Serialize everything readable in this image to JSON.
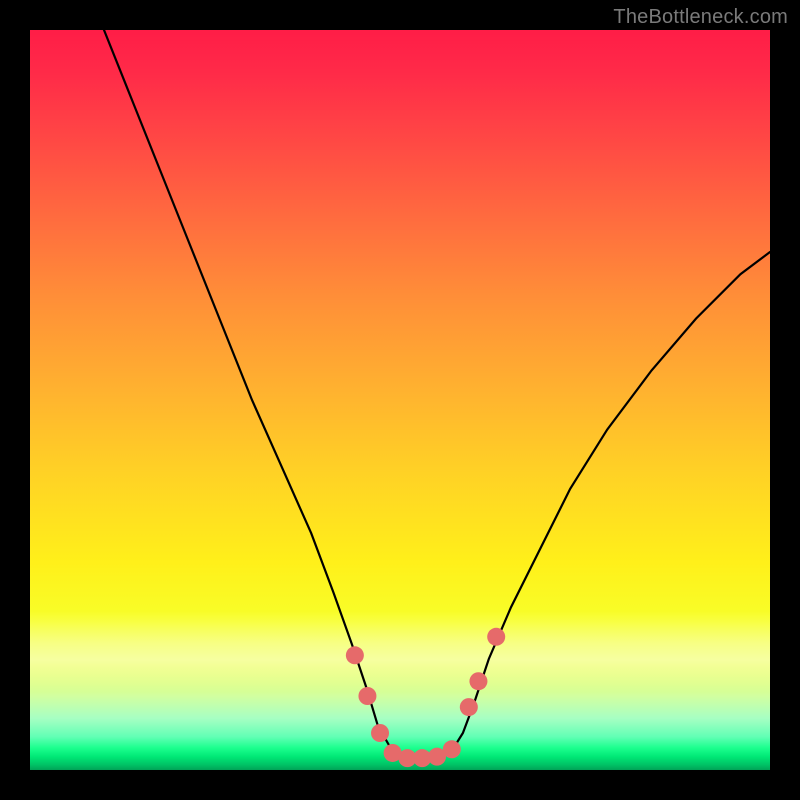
{
  "watermark": {
    "text": "TheBottleneck.com"
  },
  "chart_data": {
    "type": "line",
    "title": "",
    "xlabel": "",
    "ylabel": "",
    "xlim": [
      0,
      100
    ],
    "ylim": [
      0,
      100
    ],
    "grid": false,
    "legend": false,
    "background_gradient": {
      "orientation": "vertical",
      "stops": [
        {
          "pos": 0.0,
          "color": "#ff1d47"
        },
        {
          "pos": 0.14,
          "color": "#ff4545"
        },
        {
          "pos": 0.36,
          "color": "#ff8e38"
        },
        {
          "pos": 0.6,
          "color": "#ffd225"
        },
        {
          "pos": 0.8,
          "color": "#f7ff2a"
        },
        {
          "pos": 0.93,
          "color": "#a7ffc3"
        },
        {
          "pos": 0.97,
          "color": "#1cff8e"
        },
        {
          "pos": 1.0,
          "color": "#00a357"
        }
      ]
    },
    "series": [
      {
        "name": "bottleneck-curve",
        "color": "#000000",
        "stroke_width": 2.2,
        "x": [
          10,
          14,
          18,
          22,
          26,
          30,
          34,
          38,
          41,
          43.5,
          45.5,
          47,
          49,
          51,
          53,
          55,
          57,
          58.5,
          60,
          62,
          65,
          69,
          73,
          78,
          84,
          90,
          96,
          100
        ],
        "y": [
          100,
          90,
          80,
          70,
          60,
          50,
          41,
          32,
          24,
          17,
          11,
          6,
          2.5,
          1.6,
          1.6,
          1.6,
          2.6,
          5,
          9,
          15,
          22,
          30,
          38,
          46,
          54,
          61,
          67,
          70
        ]
      }
    ],
    "markers": {
      "name": "highlight-dots",
      "color": "#e66a6a",
      "radius": 9,
      "points": [
        {
          "x": 43.9,
          "y": 15.5
        },
        {
          "x": 45.6,
          "y": 10.0
        },
        {
          "x": 47.3,
          "y": 5.0
        },
        {
          "x": 49.0,
          "y": 2.3
        },
        {
          "x": 51.0,
          "y": 1.6
        },
        {
          "x": 53.0,
          "y": 1.6
        },
        {
          "x": 55.0,
          "y": 1.8
        },
        {
          "x": 57.0,
          "y": 2.8
        },
        {
          "x": 59.3,
          "y": 8.5
        },
        {
          "x": 60.6,
          "y": 12.0
        },
        {
          "x": 63.0,
          "y": 18.0
        }
      ]
    }
  }
}
